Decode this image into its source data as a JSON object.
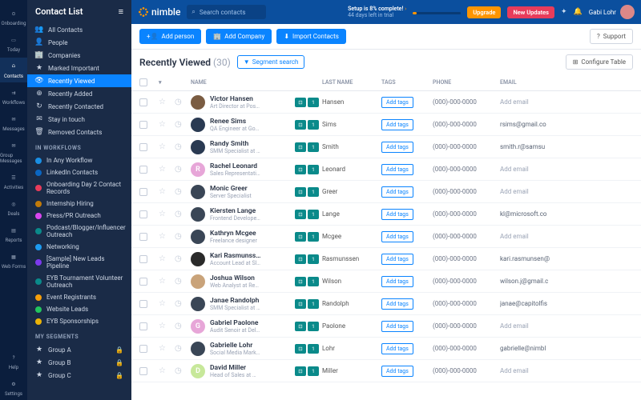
{
  "rail": [
    {
      "label": "Onboarding",
      "icon": "⊙"
    },
    {
      "label": "Today",
      "icon": "▭"
    },
    {
      "label": "Contacts",
      "icon": "⩍",
      "active": true
    },
    {
      "label": "Workflows",
      "icon": "⇉"
    },
    {
      "label": "Messages",
      "icon": "✉"
    },
    {
      "label": "Group Messages",
      "icon": "✉"
    },
    {
      "label": "Activities",
      "icon": "☰"
    },
    {
      "label": "Deals",
      "icon": "◎"
    },
    {
      "label": "Reports",
      "icon": "▤"
    },
    {
      "label": "Web Forms",
      "icon": "▦"
    }
  ],
  "rail_bottom": [
    {
      "label": "Help",
      "icon": "?"
    },
    {
      "label": "Settings",
      "icon": "⚙"
    }
  ],
  "sidebar_title": "Contact List",
  "sidebar_groups": [
    {
      "items": [
        {
          "icon": "👥",
          "label": "All Contacts"
        },
        {
          "icon": "👤",
          "label": "People"
        },
        {
          "icon": "🏢",
          "label": "Companies"
        },
        {
          "icon": "★",
          "label": "Marked Important"
        },
        {
          "icon": "👁",
          "label": "Recently Viewed",
          "active": true
        },
        {
          "icon": "⊕",
          "label": "Recently Added"
        },
        {
          "icon": "↻",
          "label": "Recently Contacted"
        },
        {
          "icon": "✉",
          "label": "Stay in touch"
        },
        {
          "icon": "🗑",
          "label": "Removed Contacts"
        }
      ]
    },
    {
      "header": "IN WORKFLOWS",
      "items": [
        {
          "dot": "#1a8fe3",
          "label": "In Any Workflow"
        },
        {
          "dot": "#0a66c2",
          "label": "LinkedIn Contacts"
        },
        {
          "dot": "#e83c5b",
          "label": "Onboarding Day 2 Contact Records"
        },
        {
          "dot": "#c27b0a",
          "label": "Internship Hiring"
        },
        {
          "dot": "#d946ef",
          "label": "Press/PR Outreach"
        },
        {
          "dot": "#0a8a8a",
          "label": "Podcast/Blogger/Influencer Outreach"
        },
        {
          "dot": "#1d9bf0",
          "label": "Networking"
        },
        {
          "dot": "#7c3aed",
          "label": "[Sample] New Leads Pipeline"
        },
        {
          "dot": "#0a8a8a",
          "label": "EYB Tournament Volunteer Outreach"
        },
        {
          "dot": "#f59e0b",
          "label": "Event Registrants"
        },
        {
          "dot": "#22c55e",
          "label": "Website Leads"
        },
        {
          "dot": "#eab308",
          "label": "EYB Sponsorships"
        }
      ]
    },
    {
      "header": "MY SEGMENTS",
      "items": [
        {
          "icon": "★",
          "label": "Group A",
          "lock": true
        },
        {
          "icon": "★",
          "label": "Group B",
          "lock": true
        },
        {
          "icon": "★",
          "label": "Group C",
          "lock": true
        }
      ]
    }
  ],
  "logo": "nimble",
  "search_placeholder": "Search contacts",
  "setup": {
    "title": "Setup is 8% complete!",
    "sub": "44 days left in trial"
  },
  "upgrade": "Upgrade",
  "new_updates": "New Updates",
  "user": "Gabi Lohr",
  "toolbar": {
    "add_person": "Add person",
    "add_company": "Add Company",
    "import": "Import Contacts",
    "support": "Support"
  },
  "heading": {
    "title": "Recently Viewed",
    "count": "(30)",
    "segment": "Segment search",
    "configure": "Configure Table"
  },
  "columns": {
    "name": "NAME",
    "last": "LAST NAME",
    "tags": "TAGS",
    "phone": "PHONE",
    "email": "EMAIL"
  },
  "tag_label": "Add tags",
  "add_email_label": "Add email",
  "rows": [
    {
      "name": "Victor Hansen",
      "role": "Art Director at Pos…",
      "last": "Hansen",
      "phone": "(000)-000-0000",
      "email": "",
      "avc": "#7a5c42"
    },
    {
      "name": "Renee Sims",
      "role": "QA Engineer at Go…",
      "last": "Sims",
      "phone": "(000)-000-0000",
      "email": "rsims@gmail.co",
      "avc": "#2a3a52"
    },
    {
      "name": "Randy Smith",
      "role": "SMM Specialist at …",
      "last": "Smith",
      "phone": "(000)-000-0000",
      "email": "smith.r@samsu",
      "avc": "#2a3a52"
    },
    {
      "name": "Rachel Leonard",
      "role": "Sales Representati…",
      "last": "Leonard",
      "phone": "(000)-000-0000",
      "email": "",
      "avc": "#e7a6d8",
      "init": "R"
    },
    {
      "name": "Monic Greer",
      "role": "Server Specialist",
      "last": "Greer",
      "phone": "(000)-000-0000",
      "email": "",
      "avc": "#3a4656"
    },
    {
      "name": "Kiersten Lange",
      "role": "Frontend Develope…",
      "last": "Lange",
      "phone": "(000)-000-0000",
      "email": "kl@microsoft.co",
      "avc": "#3a4656"
    },
    {
      "name": "Kathryn Mcgee",
      "role": "Freelance designer",
      "last": "Mcgee",
      "phone": "(000)-000-0000",
      "email": "",
      "avc": "#3a4656"
    },
    {
      "name": "Kari Rasmunss…",
      "role": "Account Lead at Sl…",
      "last": "Rasmunssen",
      "phone": "(000)-000-0000",
      "email": "kari.rasmunsen@",
      "avc": "#2a2a2a"
    },
    {
      "name": "Joshua Wilson",
      "role": "Web Analyst at Re…",
      "last": "Wilson",
      "phone": "(000)-000-0000",
      "email": "wilson.j@gmail.c",
      "avc": "#c9a37a"
    },
    {
      "name": "Janae Randolph",
      "role": "SMM Specialist at …",
      "last": "Randolph",
      "phone": "(000)-000-0000",
      "email": "janae@capitolfis",
      "avc": "#3a4656"
    },
    {
      "name": "Gabriel Paolone",
      "role": "Audit Senoir at Del…",
      "last": "Paolone",
      "phone": "(000)-000-0000",
      "email": "",
      "avc": "#e7a6d8",
      "init": "G"
    },
    {
      "name": "Gabrielle Lohr",
      "role": "Social Media Mark…",
      "last": "Lohr",
      "phone": "(000)-000-0000",
      "email": "gabrielle@nimbl",
      "avc": "#3a4656"
    },
    {
      "name": "David Miller",
      "role": "Head of Sales at …",
      "last": "Miller",
      "phone": "(000)-000-0000",
      "email": "",
      "avc": "#c7e89a",
      "init": "D"
    }
  ]
}
